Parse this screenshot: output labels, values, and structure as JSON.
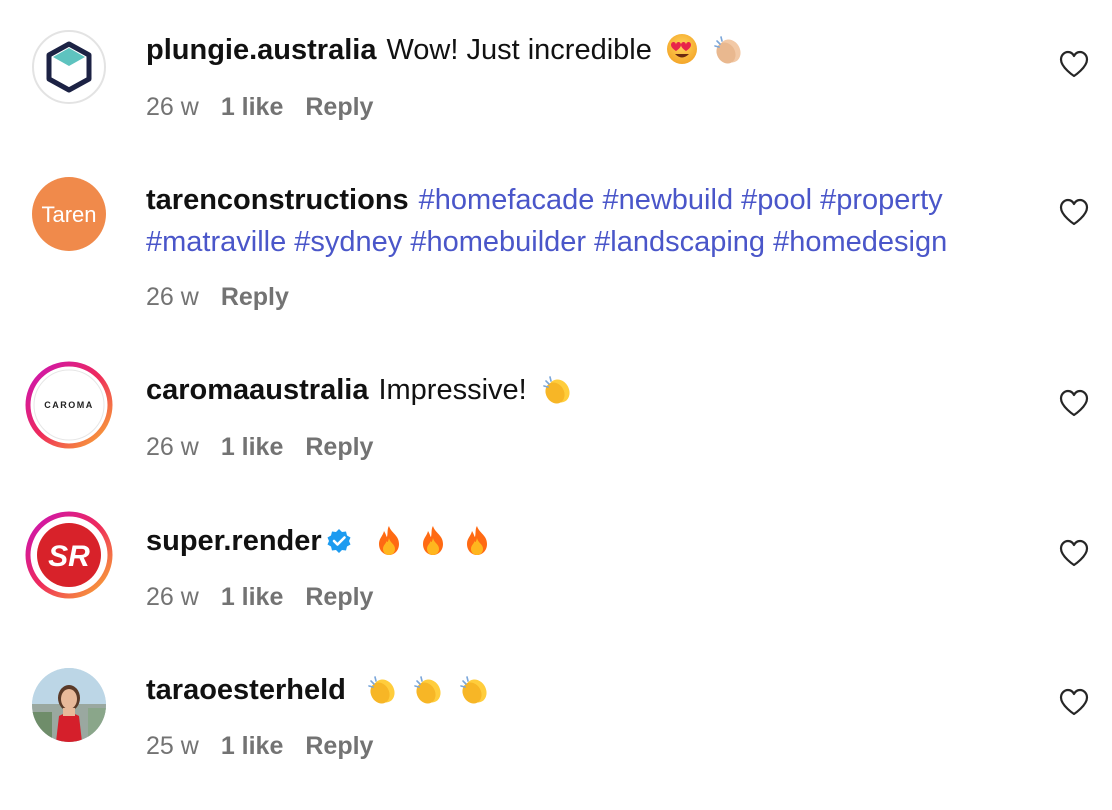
{
  "comments": [
    {
      "username": "plungie.australia",
      "text": "Wow! Just incredible",
      "emojis": [
        "heart-eyes-emoji",
        "clapping-hands-emoji"
      ],
      "time": "26 w",
      "likes": "1 like",
      "reply": "Reply"
    },
    {
      "username": "tarenconstructions",
      "hashtags_line1": "#homefacade #newbuild #pool #property",
      "hashtags_line2": "#matraville #sydney #homebuilder #landscaping #homedesign",
      "avatar_text": "Taren",
      "time": "26 w",
      "reply": "Reply"
    },
    {
      "username": "caromaaustralia",
      "text": "Impressive!",
      "avatar_text": "CAROMA",
      "emojis": [
        "clapping-hands-emoji"
      ],
      "time": "26 w",
      "likes": "1 like",
      "reply": "Reply"
    },
    {
      "username": "super.render",
      "verified": true,
      "avatar_text": "SR",
      "emojis": [
        "fire-emoji",
        "fire-emoji",
        "fire-emoji"
      ],
      "time": "26 w",
      "likes": "1 like",
      "reply": "Reply"
    },
    {
      "username": "taraoesterheld",
      "emojis": [
        "clapping-hands-emoji",
        "clapping-hands-emoji",
        "clapping-hands-emoji"
      ],
      "time": "25 w",
      "likes": "1 like",
      "reply": "Reply"
    }
  ],
  "colors": {
    "hashtag": "#4a56c9",
    "meta_text": "#737373",
    "verified": "#1d9bf0",
    "taren_orange": "#f08a4b",
    "story_ring_start": "#d3149b",
    "story_ring_end": "#f9b233"
  }
}
